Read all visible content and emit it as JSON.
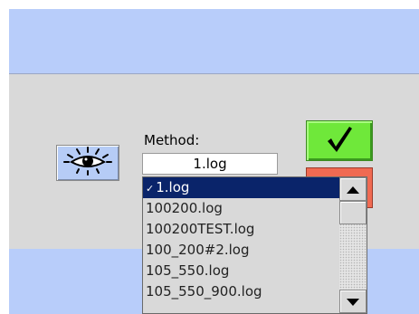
{
  "method": {
    "label": "Method:",
    "selected_value": "1.log",
    "options": [
      "1.log",
      "100200.log",
      "100200TEST.log",
      "100_200#2.log",
      "105_550.log",
      "105_550_900.log"
    ],
    "check_glyph": "✓"
  },
  "icons": {
    "view_button": "eye-icon",
    "confirm_button": "checkmark-icon",
    "scroll_up": "up-arrow-icon",
    "scroll_down": "down-arrow-icon"
  },
  "colors": {
    "band_blue": "#b8cdfa",
    "panel_gray": "#d9d9d9",
    "confirm_green": "#6fe83a",
    "cancel_red": "#f06a52",
    "selection_navy": "#0a246a"
  }
}
